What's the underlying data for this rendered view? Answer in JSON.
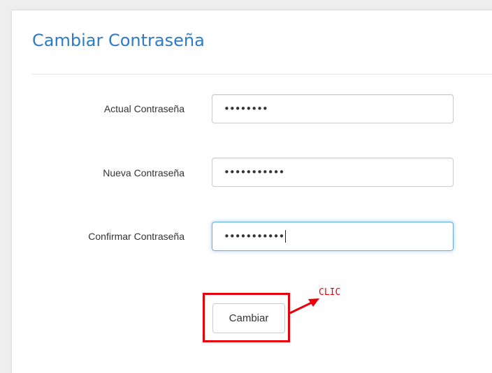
{
  "form": {
    "title": "Cambiar Contraseña",
    "fields": [
      {
        "label": "Actual Contraseña",
        "value": "••••••••"
      },
      {
        "label": "Nueva Contraseña",
        "value": "•••••••••••"
      },
      {
        "label": "Confirmar Contraseña",
        "value": "•••••••••••"
      }
    ],
    "submit_label": "Cambiar"
  },
  "annotation": {
    "text": "CLIC",
    "color": "#e8000b",
    "icon": "arrow-icon"
  },
  "colors": {
    "title": "#2e7bc4",
    "focus_border": "#66afe9"
  }
}
